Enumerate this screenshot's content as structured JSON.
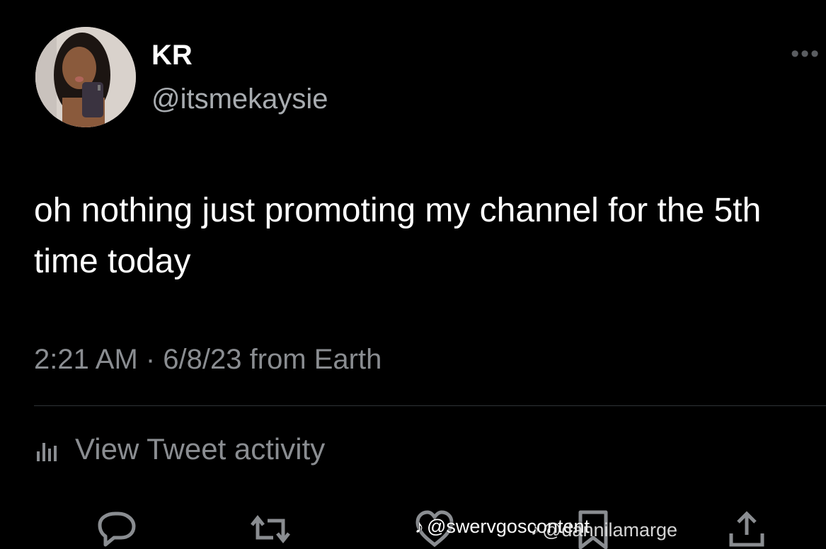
{
  "tweet": {
    "author_name": "KR",
    "author_handle": "@itsmekaysie",
    "more_icon": "more-horizontal-icon",
    "text": "oh nothing just promoting my channel for the 5th time today",
    "timestamp": "2:21 AM · 6/8/23 from Earth",
    "activity_label": "View Tweet activity",
    "activity_icon": "bar-chart-icon"
  },
  "actions": [
    {
      "name": "reply",
      "icon": "reply-bubble-icon"
    },
    {
      "name": "retweet",
      "icon": "retweet-icon"
    },
    {
      "name": "like",
      "icon": "heart-icon"
    },
    {
      "name": "bookmark",
      "icon": "bookmark-icon"
    },
    {
      "name": "share",
      "icon": "share-icon"
    }
  ],
  "watermarks": [
    {
      "text": "@swervgoscontent",
      "icon": "tiktok-icon"
    },
    {
      "text": "@dannilamarge",
      "icon": "tiktok-icon"
    }
  ],
  "colors": {
    "background": "#000000",
    "primary_text": "#ffffff",
    "secondary_text": "#8a8d91",
    "divider": "#2f3336"
  }
}
